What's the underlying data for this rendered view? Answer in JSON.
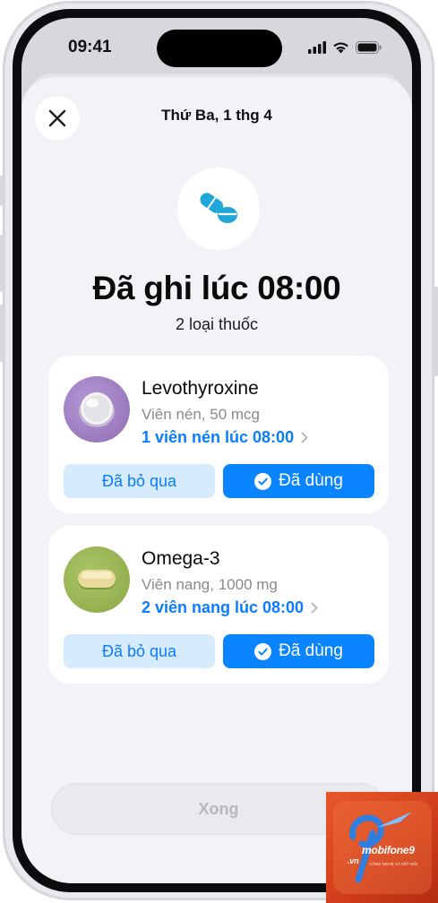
{
  "status_bar": {
    "time": "09:41"
  },
  "sheet": {
    "date_title": "Thứ Ba, 1 thg 4"
  },
  "summary": {
    "headline": "Đã ghi lúc 08:00",
    "subtitle": "2 loại thuốc"
  },
  "medications": [
    {
      "name": "Levothyroxine",
      "form": "Viên nén, 50 mcg",
      "dose": "1 viên nén lúc 08:00",
      "skip_label": "Đã bỏ qua",
      "taken_label": "Đã dùng",
      "color": "#a98bc9"
    },
    {
      "name": "Omega-3",
      "form": "Viên nang, 1000 mg",
      "dose": "2 viên nang lúc 08:00",
      "skip_label": "Đã bỏ qua",
      "taken_label": "Đã dùng",
      "color": "#9db656"
    }
  ],
  "footer": {
    "done_label": "Xong"
  },
  "watermark": {
    "brand": "mobifone9",
    "domain": ".vn",
    "tagline": "CÔNG NGHỆ VÀ KẾT NỐI"
  },
  "colors": {
    "accent": "#0a84ff",
    "accent_light": "#d6ebfe",
    "pill_badge": "#1fa7d8"
  }
}
